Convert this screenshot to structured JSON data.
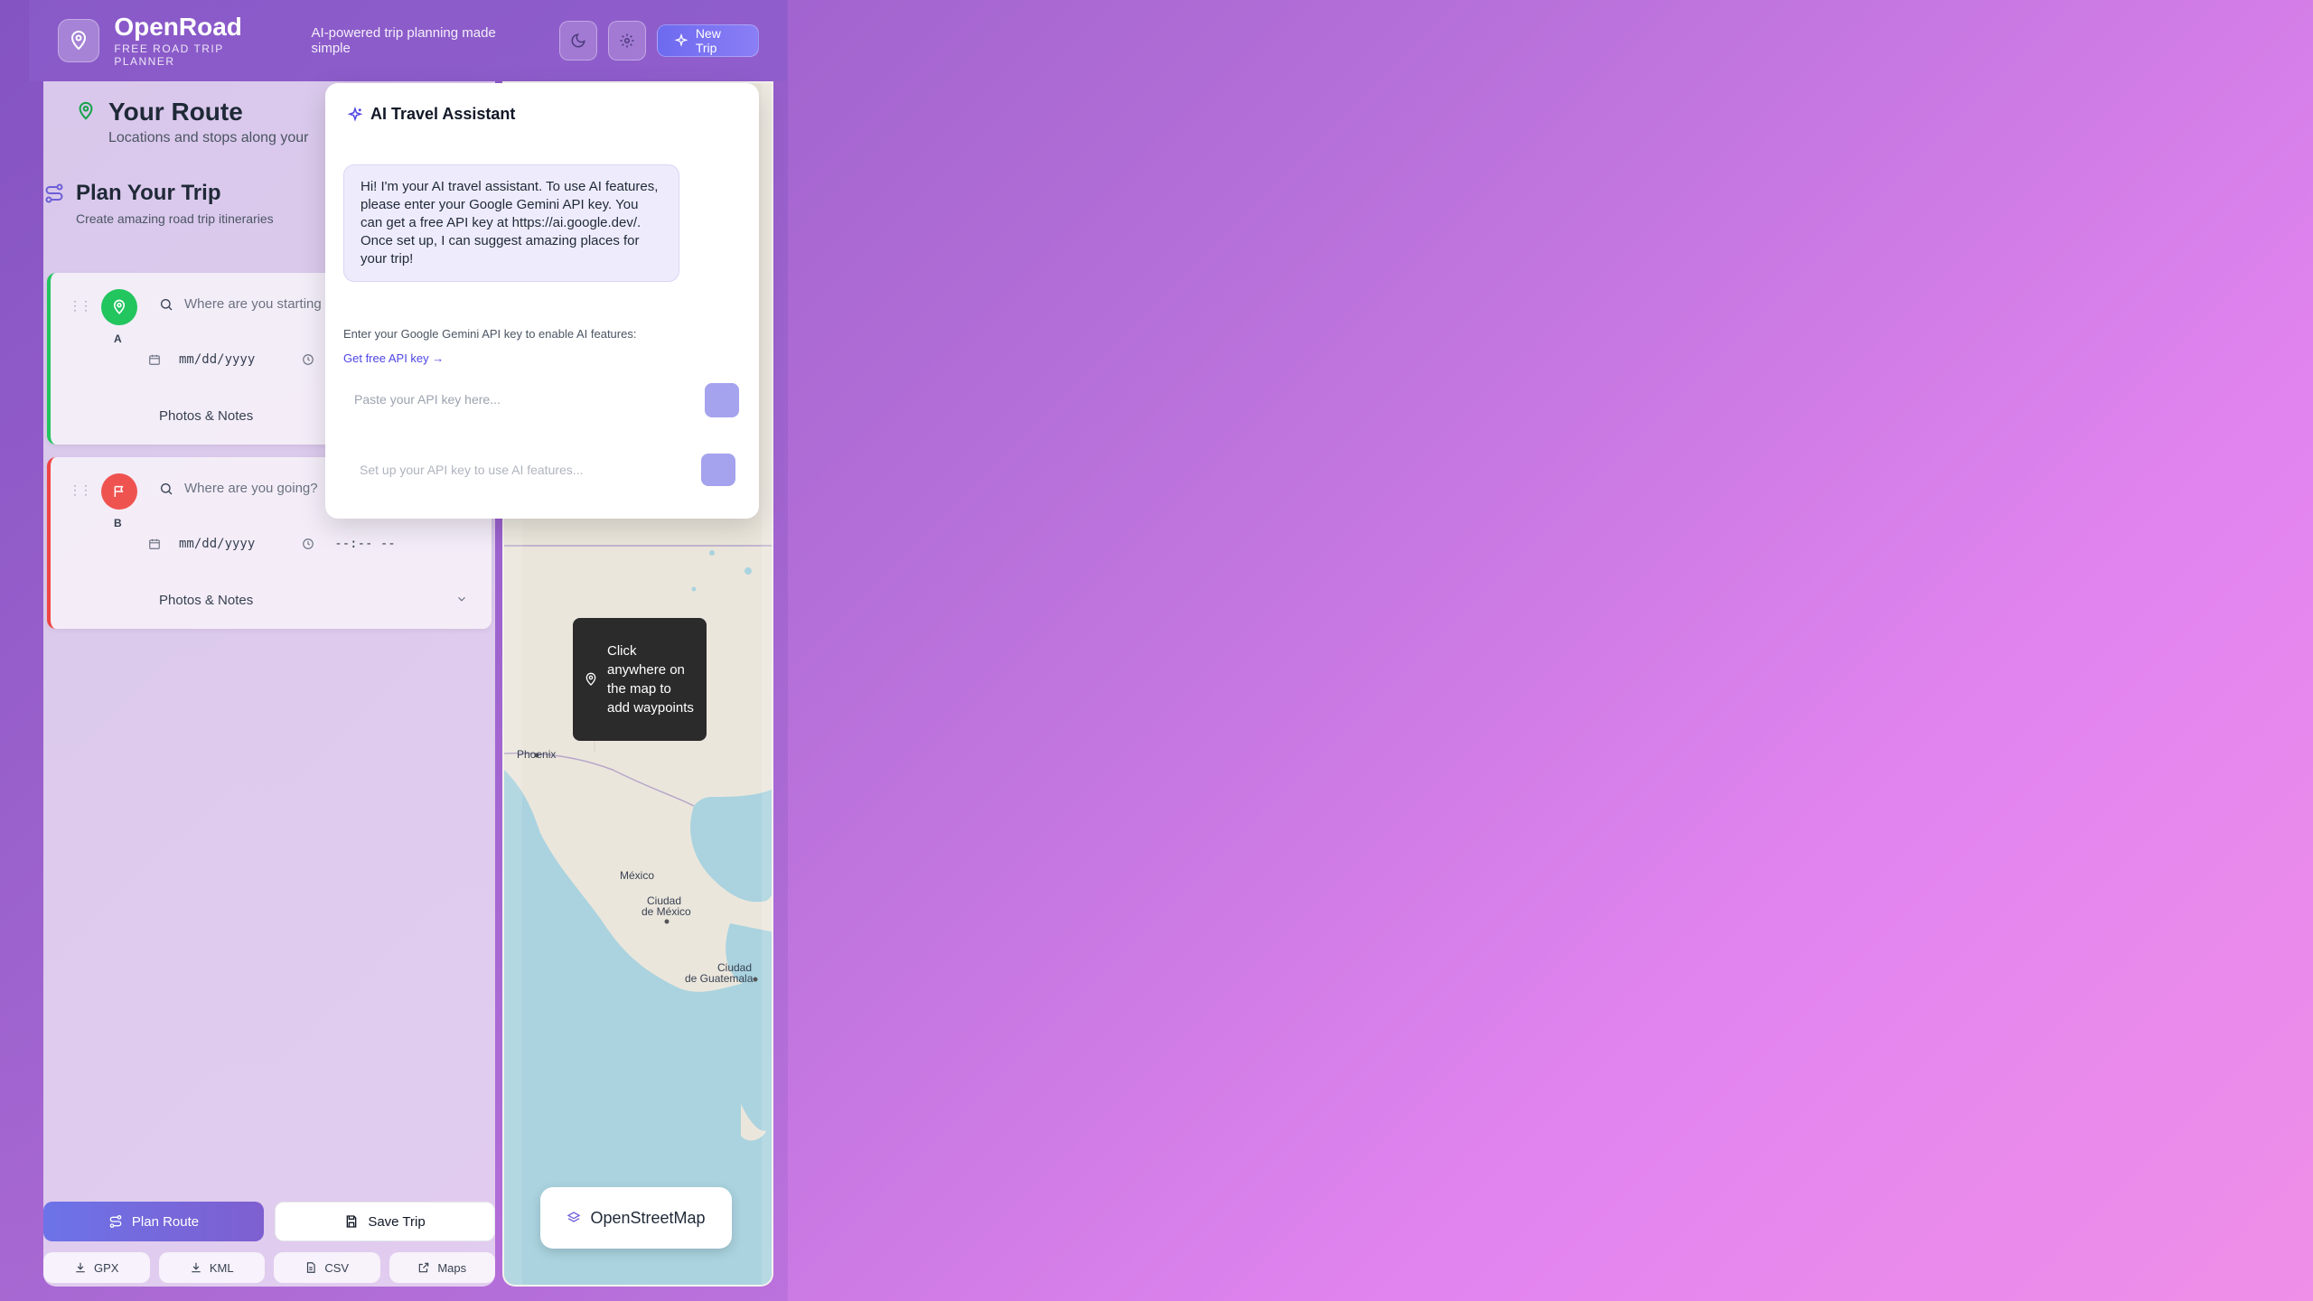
{
  "header": {
    "brand": "OpenRoad",
    "subtitle": "FREE ROAD TRIP PLANNER",
    "tagline": "AI-powered trip planning made simple",
    "new_trip_label": "New Trip"
  },
  "route": {
    "title": "Your Route",
    "subtitle": "Locations and stops along your"
  },
  "plan": {
    "title": "Plan Your Trip",
    "subtitle": "Create amazing road trip itineraries"
  },
  "stops": [
    {
      "letter": "A",
      "placeholder": "Where are you starting f",
      "date": "mm/dd/yyyy",
      "photos_label": "Photos & Notes"
    },
    {
      "letter": "B",
      "placeholder": "Where are you going?",
      "date": "mm/dd/yyyy",
      "time": "--:-- --",
      "photos_label": "Photos & Notes"
    }
  ],
  "actions": {
    "plan_route": "Plan Route",
    "save_trip": "Save Trip",
    "exports": [
      "GPX",
      "KML",
      "CSV",
      "Maps"
    ]
  },
  "map": {
    "tooltip": "Click anywhere on the map to add waypoints",
    "labels": {
      "phoenix": "Phoenix",
      "mexico": "México",
      "ciudad_mexico_1": "Ciudad",
      "ciudad_mexico_2": "de México",
      "ciudad_guatemala_1": "Ciudad",
      "ciudad_guatemala_2": "de Guatemala"
    },
    "provider_label": "OpenStreetMap"
  },
  "ai": {
    "title": "AI Travel Assistant",
    "message": "Hi! I'm your AI travel assistant. To use AI features, please enter your Google Gemini API key. You can get a free API key at https://ai.google.dev/. Once set up, I can suggest amazing places for your trip!",
    "prompt": "Enter your Google Gemini API key to enable AI features:",
    "link": "Get free API key →",
    "key_placeholder": "Paste your API key here...",
    "chat_placeholder": "Set up your API key to use AI features..."
  },
  "colors": {
    "accent": "#6d6af0",
    "start": "#22c55e",
    "end": "#ef4444",
    "water": "#aad3df"
  }
}
